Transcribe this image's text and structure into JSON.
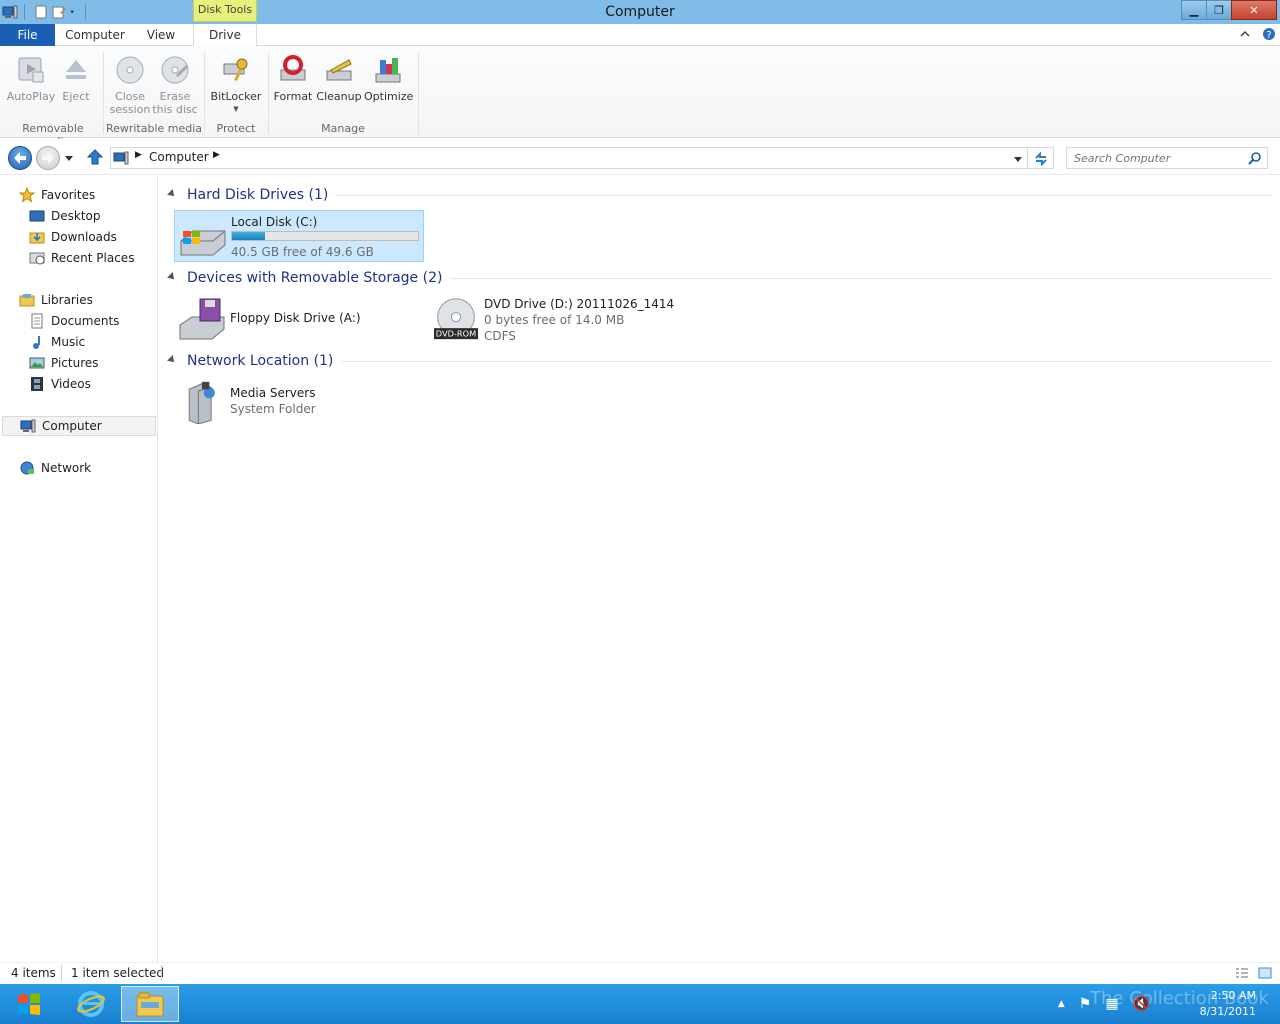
{
  "window": {
    "title": "Computer",
    "context_tab": "Disk Tools"
  },
  "ribbon": {
    "tabs": [
      {
        "label": "File"
      },
      {
        "label": "Computer"
      },
      {
        "label": "View"
      },
      {
        "label": "Drive"
      }
    ],
    "buttons": {
      "autoplay": "AutoPlay",
      "eject": "Eject",
      "close_session_1": "Close",
      "close_session_2": "session",
      "erase_1": "Erase",
      "erase_2": "this disc",
      "bitlocker": "BitLocker",
      "format": "Format",
      "cleanup": "Cleanup",
      "optimize": "Optimize"
    },
    "groups": {
      "removable": "Removable media",
      "rewritable": "Rewritable media",
      "protect": "Protect",
      "manage": "Manage"
    }
  },
  "address": {
    "crumb": "Computer",
    "search_placeholder": "Search Computer"
  },
  "nav": {
    "favorites": "Favorites",
    "desktop": "Desktop",
    "downloads": "Downloads",
    "recent": "Recent Places",
    "libraries": "Libraries",
    "documents": "Documents",
    "music": "Music",
    "pictures": "Pictures",
    "videos": "Videos",
    "computer": "Computer",
    "network": "Network"
  },
  "groups": {
    "hdd": "Hard Disk Drives (1)",
    "removable": "Devices with Removable Storage (2)",
    "network": "Network Location (1)"
  },
  "items": {
    "local_disk": {
      "name": "Local Disk (C:)",
      "free": "40.5 GB free of 49.6 GB",
      "used_fraction": 0.18
    },
    "floppy": {
      "name": "Floppy Disk Drive (A:)"
    },
    "dvd": {
      "name": "DVD Drive (D:) 20111026_1414",
      "free": "0 bytes free of 14.0 MB",
      "fs": "CDFS",
      "badge": "DVD-ROM"
    },
    "media": {
      "name": "Media Servers",
      "sub": "System Folder"
    }
  },
  "status": {
    "count": "4 items",
    "selected": "1 item selected"
  },
  "taskbar": {
    "time": "2:50 AM",
    "date": "8/31/2011",
    "watermark": "The Collection Book"
  },
  "colors": {
    "titlebar": "#7fbce8",
    "file_tab": "#1a5fb4",
    "context_tab": "#e6f07a",
    "taskbar": "#1a7fd0",
    "selection": "#cce8ff",
    "group_header": "#1e3287"
  }
}
